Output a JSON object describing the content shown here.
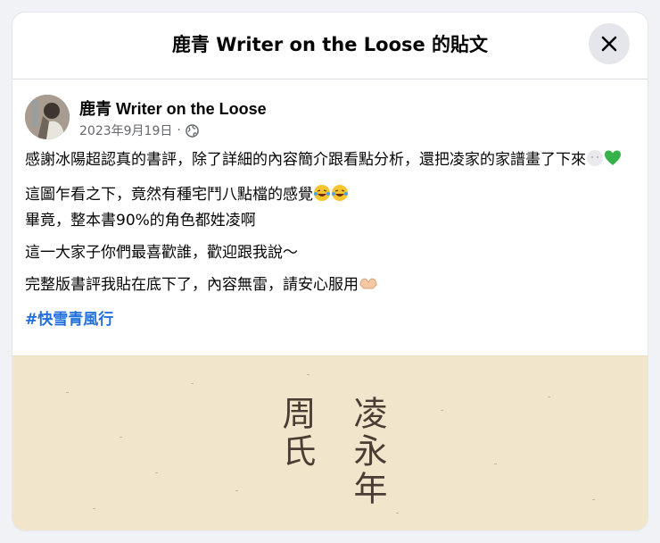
{
  "dialog": {
    "title": "鹿青 Writer on the Loose 的貼文"
  },
  "post": {
    "author": "鹿青 Writer on the Loose",
    "date": "2023年9月19日",
    "separator": "·",
    "paragraphs": [
      "感謝冰陽超認真的書評，除了詳細的內容簡介跟看點分析，還把凌家的家譜畫了下來",
      "這圖乍看之下，竟然有種宅鬥八點檔的感覺",
      "畢竟，整本書90%的角色都姓凌啊",
      "這一大家子你們最喜歡誰，歡迎跟我說～",
      "完整版書評我貼在底下了，內容無雷，請安心服用"
    ],
    "hashtag": "#快雪青風行"
  },
  "image": {
    "text_left": "周氏",
    "text_right": "凌永年"
  },
  "colors": {
    "link": "#216fdb",
    "image_bg": "#f1e6cc"
  }
}
